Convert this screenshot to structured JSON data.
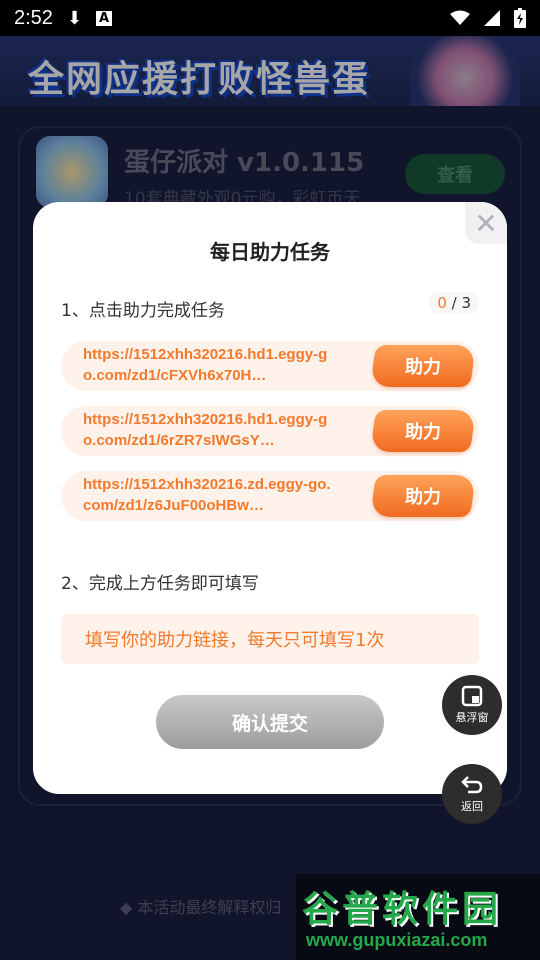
{
  "status_bar": {
    "time": "2:52",
    "icons": [
      "download-icon",
      "a-icon",
      "wifi-icon",
      "signal-icon",
      "battery-icon"
    ]
  },
  "background": {
    "banner_text": "全网应援打败怪兽蛋",
    "game_title": "蛋仔派对 v1.0.115",
    "game_desc": "10套典藏外观0元购，彩虹币天...",
    "view_label": "查看",
    "footer_note": "本活动最终解释权归"
  },
  "modal": {
    "title": "每日助力任务",
    "step1_label": "1、点击助力完成任务",
    "progress_done": "0",
    "progress_sep": " / ",
    "progress_total": "3",
    "tasks": [
      {
        "url": "https://1512xhh320216.hd1.eggy-go.com/zd1/cFXVh6x70H…",
        "button": "助力"
      },
      {
        "url": "https://1512xhh320216.hd1.eggy-go.com/zd1/6rZR7sIWGsY…",
        "button": "助力"
      },
      {
        "url": "https://1512xhh320216.zd.eggy-go.com/zd1/z6JuF00oHBw…",
        "button": "助力"
      }
    ],
    "step2_label": "2、完成上方任务即可填写",
    "fill_placeholder": "填写你的助力链接，每天只可填写1次",
    "submit_label": "确认提交",
    "close_glyph": "✕"
  },
  "floating": {
    "window_label": "悬浮窗",
    "back_label": "返回"
  },
  "watermark": {
    "title": "谷普软件园",
    "url": "www.gupuxiazai.com"
  },
  "colors": {
    "accent": "#f37a2c",
    "background": "#1b2142"
  }
}
